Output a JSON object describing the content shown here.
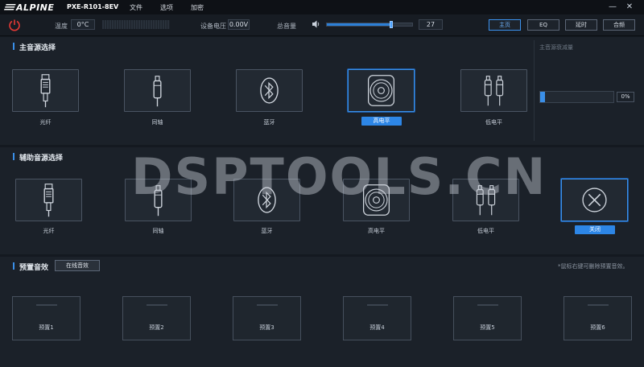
{
  "titlebar": {
    "brand": "ALPINE",
    "model": "PXE-R101-8EV",
    "menu": [
      "文件",
      "选项",
      "加密"
    ]
  },
  "toolbar": {
    "temp_label": "温度",
    "temp_value": "0°C",
    "voltage_label": "设备电压",
    "voltage_value": "0.00V",
    "volume_label": "总音量",
    "volume_value": "27",
    "tabs": [
      "主页",
      "EQ",
      "延时",
      "合频"
    ],
    "active_tab": "主页"
  },
  "main_source": {
    "title": "主音源选择",
    "items": [
      "光纤",
      "同轴",
      "蓝牙",
      "高电平",
      "低电平"
    ],
    "selected": "高电平",
    "attenuation_label": "主音源衰减量",
    "attenuation_value": "0%"
  },
  "aux_source": {
    "title": "辅助音源选择",
    "items": [
      "光纤",
      "同轴",
      "蓝牙",
      "高电平",
      "低电平",
      "关闭"
    ],
    "selected": "关闭"
  },
  "presets": {
    "title": "预置音效",
    "online_button": "在线音效",
    "hint": "*鼠标右键可删除预置音效。",
    "items": [
      "预置1",
      "预置2",
      "预置3",
      "预置4",
      "预置5",
      "预置6"
    ]
  },
  "watermark": "DSPTOOLS.CN",
  "colors": {
    "accent": "#3a8fe8",
    "background": "#141920",
    "power": "#e53935"
  }
}
